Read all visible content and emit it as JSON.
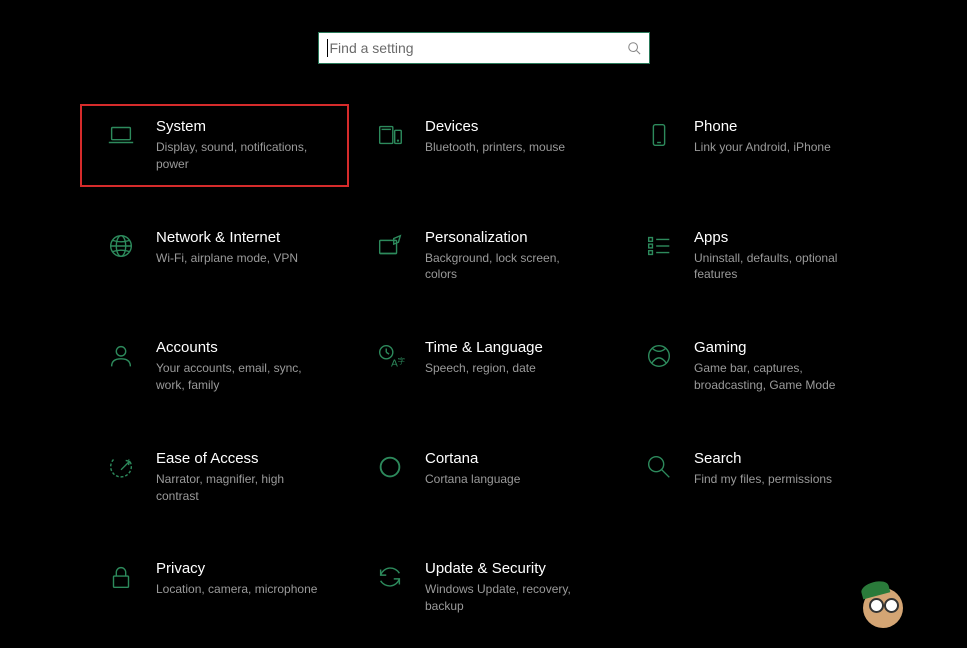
{
  "search": {
    "placeholder": "Find a setting"
  },
  "categories": [
    {
      "id": "system",
      "title": "System",
      "desc": "Display, sound, notifications, power",
      "highlighted": true
    },
    {
      "id": "devices",
      "title": "Devices",
      "desc": "Bluetooth, printers, mouse"
    },
    {
      "id": "phone",
      "title": "Phone",
      "desc": "Link your Android, iPhone"
    },
    {
      "id": "network",
      "title": "Network & Internet",
      "desc": "Wi-Fi, airplane mode, VPN"
    },
    {
      "id": "personalization",
      "title": "Personalization",
      "desc": "Background, lock screen, colors"
    },
    {
      "id": "apps",
      "title": "Apps",
      "desc": "Uninstall, defaults, optional features"
    },
    {
      "id": "accounts",
      "title": "Accounts",
      "desc": "Your accounts, email, sync, work, family"
    },
    {
      "id": "time",
      "title": "Time & Language",
      "desc": "Speech, region, date"
    },
    {
      "id": "gaming",
      "title": "Gaming",
      "desc": "Game bar, captures, broadcasting, Game Mode"
    },
    {
      "id": "ease",
      "title": "Ease of Access",
      "desc": "Narrator, magnifier, high contrast"
    },
    {
      "id": "cortana",
      "title": "Cortana",
      "desc": "Cortana language"
    },
    {
      "id": "search",
      "title": "Search",
      "desc": "Find my files, permissions"
    },
    {
      "id": "privacy",
      "title": "Privacy",
      "desc": "Location, camera, microphone"
    },
    {
      "id": "update",
      "title": "Update & Security",
      "desc": "Windows Update, recovery, backup"
    }
  ],
  "colors": {
    "accent": "#2d8a5c",
    "highlight": "#d62b2b"
  }
}
